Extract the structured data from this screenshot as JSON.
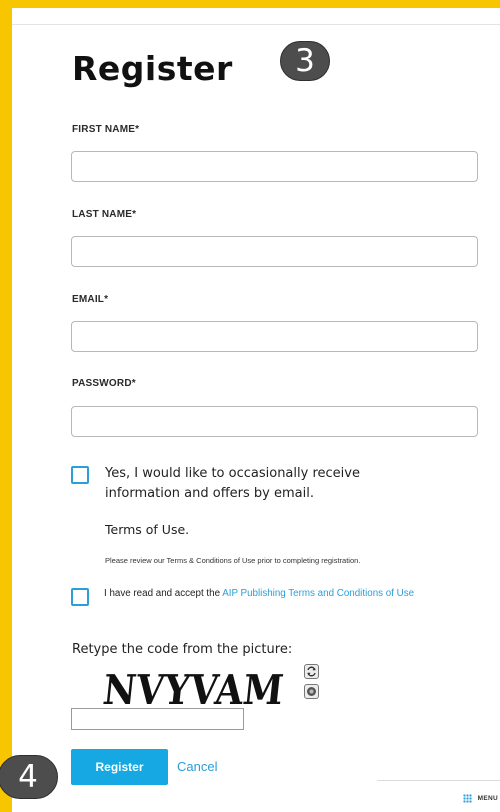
{
  "title": "Register",
  "badges": {
    "step_top": "3",
    "step_bottom": "4"
  },
  "form": {
    "first_name": {
      "label": "FIRST NAME*",
      "value": ""
    },
    "last_name": {
      "label": "LAST NAME*",
      "value": ""
    },
    "email": {
      "label": "EMAIL*",
      "value": ""
    },
    "password": {
      "label": "PASSWORD*",
      "value": ""
    },
    "opt_in": {
      "checked": false,
      "text": "Yes, I would like to occasionally receive information and offers by email."
    },
    "terms": {
      "heading": "Terms of Use.",
      "note": "Please review our Terms & Conditions of Use prior to completing registration.",
      "accept_prefix": "I have read and accept the ",
      "accept_link": "AIP Publishing Terms and Conditions of Use",
      "checked": false
    },
    "captcha": {
      "label": "Retype the code from the picture:",
      "code_image_text": "NVYVAM",
      "value": "",
      "refresh_icon": "refresh-icon",
      "audio_icon": "audio-icon"
    },
    "register_label": "Register",
    "cancel_label": "Cancel"
  },
  "footer": {
    "menu_label": "MENU",
    "menu_icon": "grid-icon"
  },
  "colors": {
    "frame": "#f7c600",
    "accent": "#16a8e2",
    "link": "#2a9fd8",
    "badge": "#4d4d4d"
  }
}
